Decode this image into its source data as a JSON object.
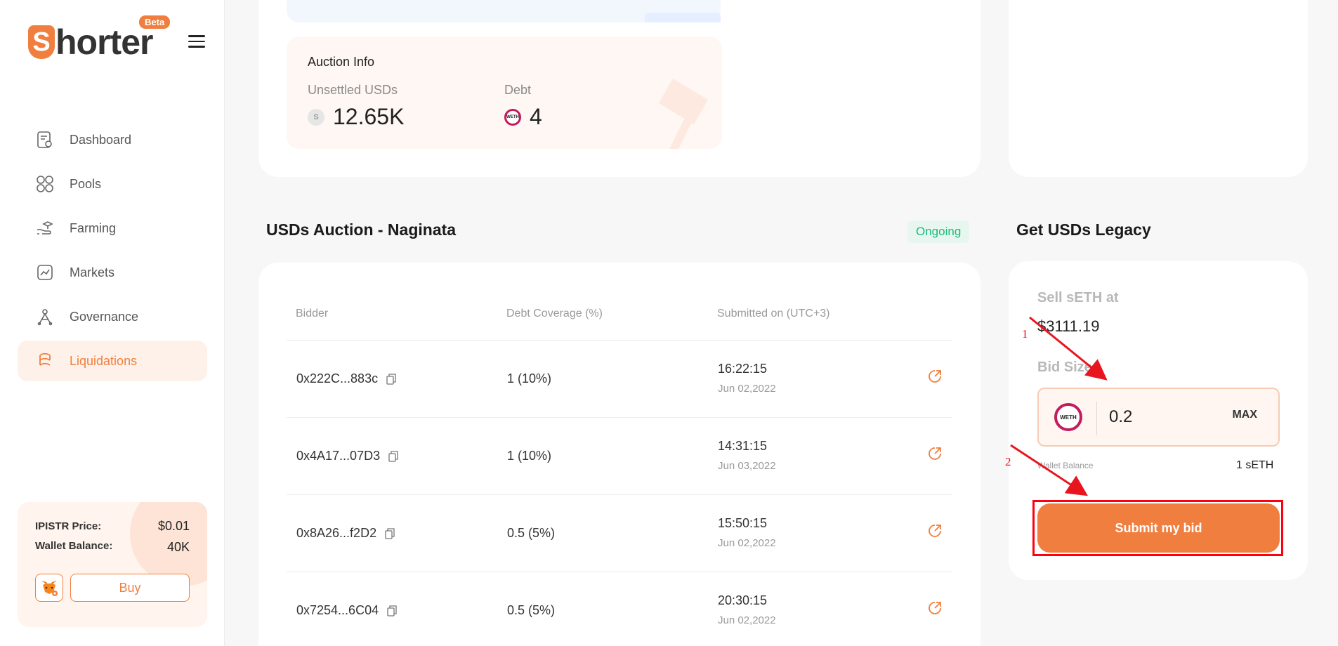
{
  "app": {
    "logo_letter": "S",
    "logo_text": "horter",
    "badge": "Beta"
  },
  "sidebar": {
    "items": [
      {
        "label": "Dashboard",
        "icon": "dashboard-icon"
      },
      {
        "label": "Pools",
        "icon": "pools-icon"
      },
      {
        "label": "Farming",
        "icon": "farming-icon"
      },
      {
        "label": "Markets",
        "icon": "markets-icon"
      },
      {
        "label": "Governance",
        "icon": "governance-icon"
      },
      {
        "label": "Liquidations",
        "icon": "liquidations-icon",
        "active": true
      }
    ],
    "wallet": {
      "price_label": "IPISTR Price:",
      "price_value": "$0.01",
      "balance_label": "Wallet Balance:",
      "balance_value": "40K",
      "buy_label": "Buy"
    }
  },
  "auction_info": {
    "title": "Auction Info",
    "unsettled_label": "Unsettled USDs",
    "unsettled_value": "12.65K",
    "debt_label": "Debt",
    "debt_value": "4"
  },
  "auction": {
    "title": "USDs Auction - Naginata",
    "status": "Ongoing",
    "columns": [
      "Bidder",
      "Debt Coverage (%)",
      "Submitted on (UTC+3)"
    ],
    "rows": [
      {
        "bidder": "0x222C...883c",
        "coverage": "1 (10%)",
        "time": "16:22:15",
        "date": "Jun 02,2022"
      },
      {
        "bidder": "0x4A17...07D3",
        "coverage": "1 (10%)",
        "time": "14:31:15",
        "date": "Jun 03,2022"
      },
      {
        "bidder": "0x8A26...f2D2",
        "coverage": "0.5 (5%)",
        "time": "15:50:15",
        "date": "Jun 02,2022"
      },
      {
        "bidder": "0x7254...6C04",
        "coverage": "0.5 (5%)",
        "time": "20:30:15",
        "date": "Jun 02,2022"
      }
    ]
  },
  "bid_panel": {
    "title": "Get USDs Legacy",
    "sell_label": "Sell sETH at",
    "price": "$3111.19",
    "bid_size_label": "Bid Size",
    "bid_value": "0.2",
    "max_label": "MAX",
    "wallet_balance_label": "Wallet Balance",
    "wallet_balance_value": "1 sETH",
    "submit_label": "Submit my bid"
  },
  "annotations": {
    "step1": "1",
    "step2": "2",
    "color": "#e8151f"
  },
  "colors": {
    "accent": "#f07f3f",
    "success": "#1aba7a"
  }
}
